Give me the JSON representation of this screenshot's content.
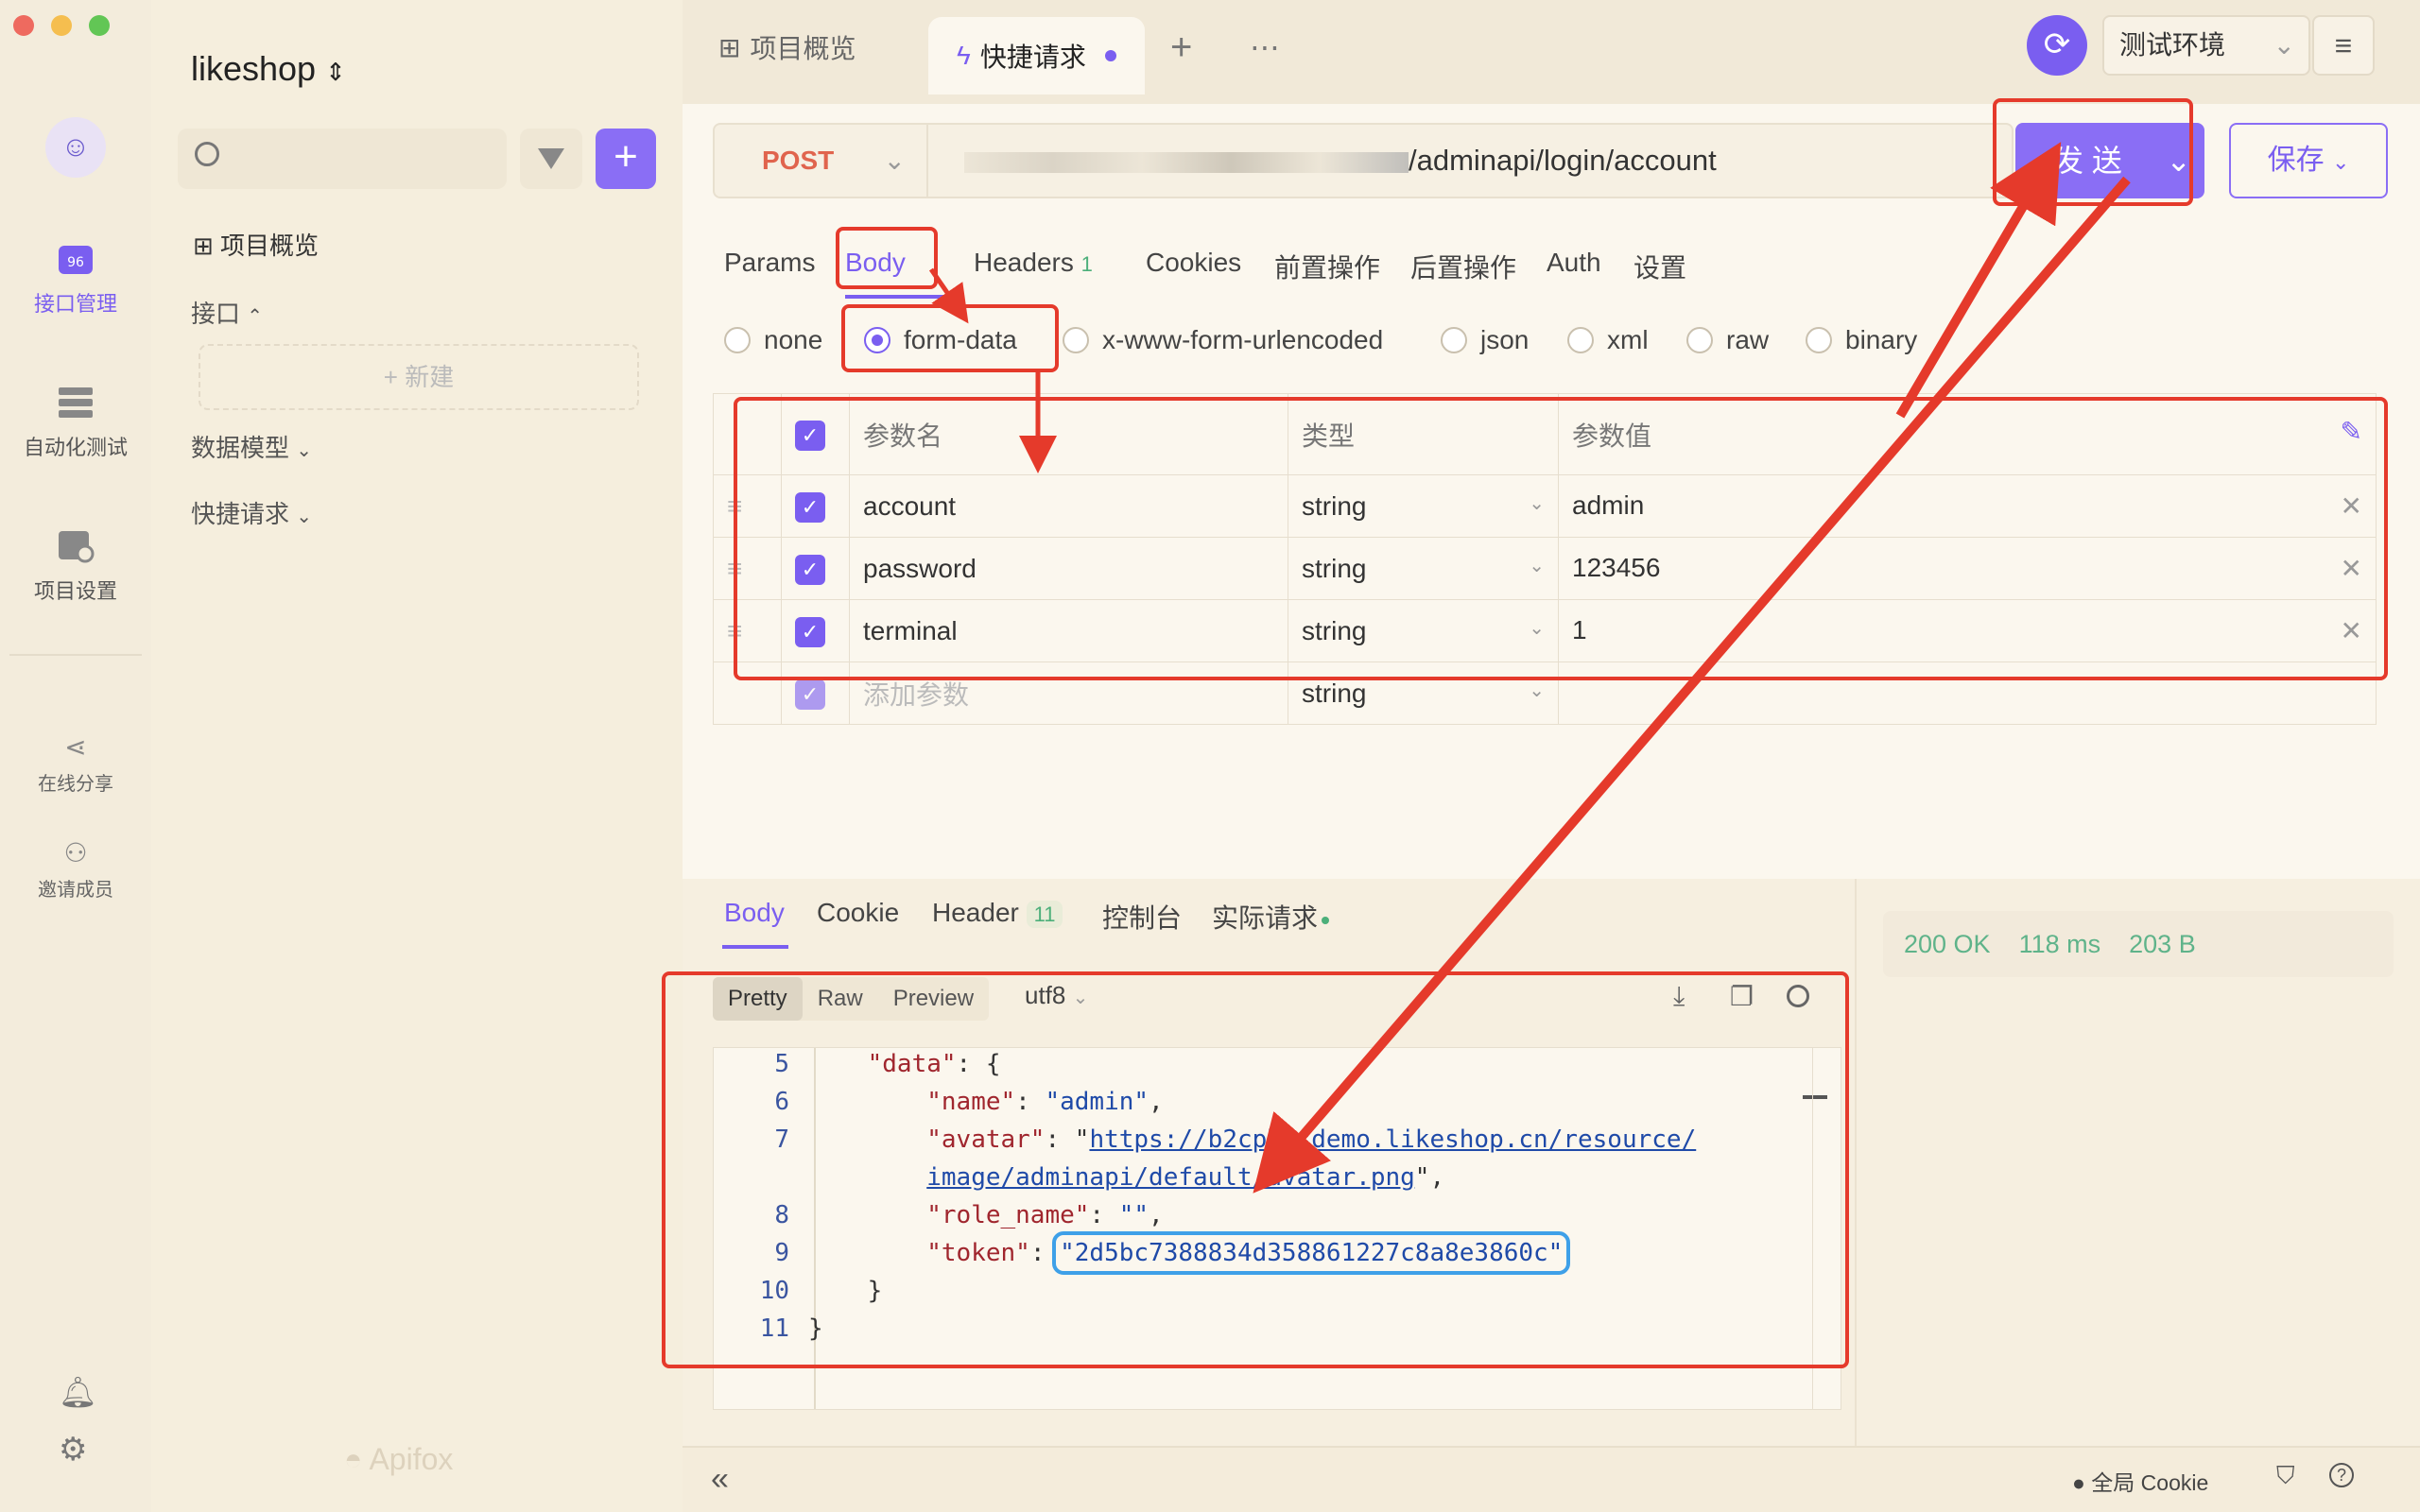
{
  "app": {
    "project": "likeshop",
    "brand": "Apifox"
  },
  "rail": {
    "items": [
      {
        "label": "接口管理",
        "icon": "api-icon",
        "active": true
      },
      {
        "label": "自动化测试",
        "icon": "automation-icon",
        "active": false
      },
      {
        "label": "项目设置",
        "icon": "project-settings-icon",
        "active": false
      }
    ],
    "share": "在线分享",
    "invite": "邀请成员"
  },
  "sidebar": {
    "overview": "项目概览",
    "interfaces": "接口",
    "new": "+ 新建",
    "models": "数据模型",
    "quick": "快捷请求"
  },
  "tabs": [
    {
      "label": "项目概览"
    },
    {
      "label": "快捷请求"
    }
  ],
  "env": {
    "name": "测试环境"
  },
  "request": {
    "method": "POST",
    "url": "/adminapi/login/account",
    "send": "发 送",
    "save": "保存"
  },
  "subtabs": {
    "params": "Params",
    "body": "Body",
    "headers": "Headers",
    "headers_count": "1",
    "cookies": "Cookies",
    "pre": "前置操作",
    "post": "后置操作",
    "auth": "Auth",
    "settings": "设置"
  },
  "body_types": [
    "none",
    "form-data",
    "x-www-form-urlencoded",
    "json",
    "xml",
    "raw",
    "binary"
  ],
  "params_table": {
    "headers": [
      "参数名",
      "类型",
      "参数值"
    ],
    "rows": [
      {
        "name": "account",
        "type": "string",
        "value": "admin"
      },
      {
        "name": "password",
        "type": "string",
        "value": "123456"
      },
      {
        "name": "terminal",
        "type": "string",
        "value": "1"
      }
    ],
    "add_placeholder": "添加参数",
    "add_type": "string"
  },
  "response": {
    "tabs": {
      "body": "Body",
      "cookie": "Cookie",
      "header": "Header",
      "header_count": "11",
      "console": "控制台",
      "actual": "实际请求"
    },
    "views": {
      "pretty": "Pretty",
      "raw": "Raw",
      "preview": "Preview",
      "encoding": "utf8"
    },
    "status": "200 OK",
    "time": "118 ms",
    "size": "203 B"
  },
  "code_lines": [
    {
      "n": "5",
      "indent": "    ",
      "key": "\"data\"",
      "rest": ": {"
    },
    {
      "n": "6",
      "indent": "        ",
      "key": "\"name\"",
      "rest": ": ",
      "val": "\"admin\"",
      "end": ","
    },
    {
      "n": "7",
      "indent": "        ",
      "key": "\"avatar\"",
      "rest": ": \"",
      "url": "https://b2cplusdemo.likeshop.cn/resource/"
    },
    {
      "n": "",
      "indent": "        ",
      "url2": "image/adminapi/default/avatar.png",
      "end": "\","
    },
    {
      "n": "8",
      "indent": "        ",
      "key": "\"role_name\"",
      "rest": ": ",
      "val": "\"\"",
      "end": ","
    },
    {
      "n": "9",
      "indent": "        ",
      "key": "\"token\"",
      "rest": ": ",
      "val": "\"2d5bc7388834d358861227c8a8e3860c\""
    },
    {
      "n": "10",
      "indent": "    ",
      "plain": "}"
    },
    {
      "n": "11",
      "indent": "",
      "plain": "}"
    }
  ],
  "footer": {
    "cookie": "全局 Cookie"
  }
}
